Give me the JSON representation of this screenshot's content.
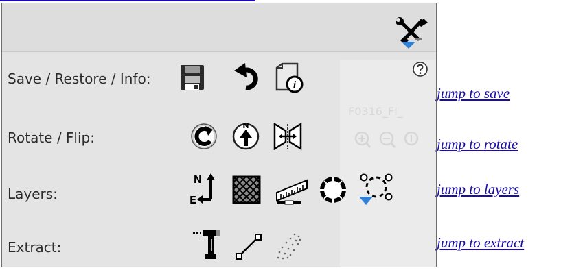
{
  "panel": {
    "background_title": "F0316_FI_",
    "rows": [
      {
        "label": "Save / Restore / Info:",
        "icons": [
          "save-icon",
          "restore-icon",
          "info-icon"
        ]
      },
      {
        "label": "Rotate / Flip:",
        "icons": [
          "rotate-icon",
          "north-up-icon",
          "flip-icon"
        ]
      },
      {
        "label": "Layers:",
        "icons": [
          "compass-layer-icon",
          "grid-layer-icon",
          "scalebar-layer-icon",
          "reticle-layer-icon",
          "points-layer-icon"
        ]
      },
      {
        "label": "Extract:",
        "icons": [
          "point-extract-icon",
          "line-extract-icon",
          "cloud-extract-icon"
        ]
      }
    ]
  },
  "links": {
    "dash": " ",
    "save": "jump to save",
    "rotate": "jump to rotate",
    "layers": "jump to layers",
    "extract": "jump to extract"
  },
  "colors": {
    "link": "#1a0dab",
    "panel_bg": "#e4e4e4",
    "accent_blue": "#2f7fd6"
  }
}
